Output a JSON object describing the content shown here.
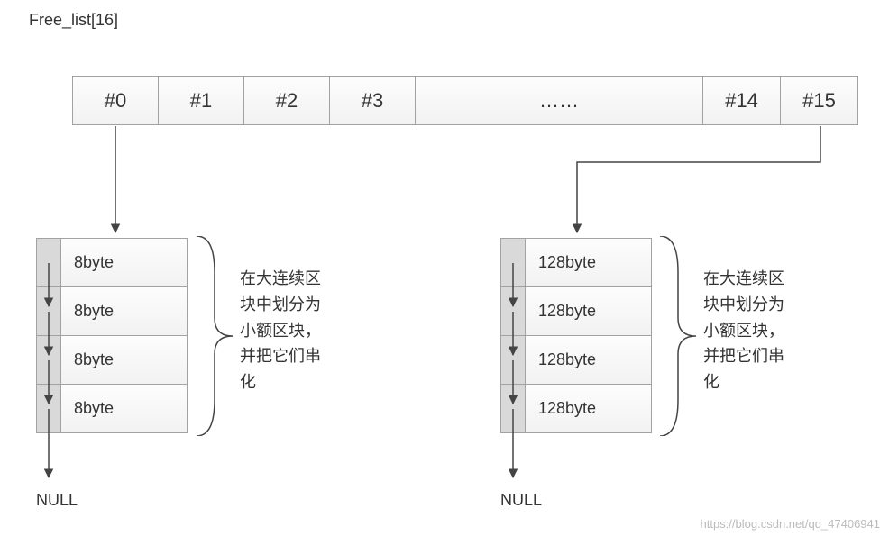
{
  "title": "Free_list[16]",
  "cells": {
    "c0": "#0",
    "c1": "#1",
    "c2": "#2",
    "c3": "#3",
    "dots": "……",
    "c14": "#14",
    "c15": "#15"
  },
  "listA": {
    "b0": "8byte",
    "b1": "8byte",
    "b2": "8byte",
    "b3": "8byte",
    "null": "NULL"
  },
  "listB": {
    "b0": "128byte",
    "b1": "128byte",
    "b2": "128byte",
    "b3": "128byte",
    "null": "NULL"
  },
  "note": "在大连续区块中划分为小额区块，并把它们串化",
  "watermark": "https://blog.csdn.net/qq_47406941",
  "chart_data": {
    "type": "diagram",
    "structure": "segregated_free_list",
    "array_name": "Free_list",
    "array_size": 16,
    "indices_shown": [
      0,
      1,
      2,
      3,
      14,
      15
    ],
    "lists": [
      {
        "index": 0,
        "block_size_bytes": 8,
        "blocks_shown": 4,
        "terminator": "NULL"
      },
      {
        "index": 15,
        "block_size_bytes": 128,
        "blocks_shown": 4,
        "terminator": "NULL"
      }
    ],
    "annotation_zh": "在大连续区块中划分为小额区块，并把它们串化",
    "annotation_en_approx": "Within the large contiguous block, partition into small blocks and chain them together"
  }
}
